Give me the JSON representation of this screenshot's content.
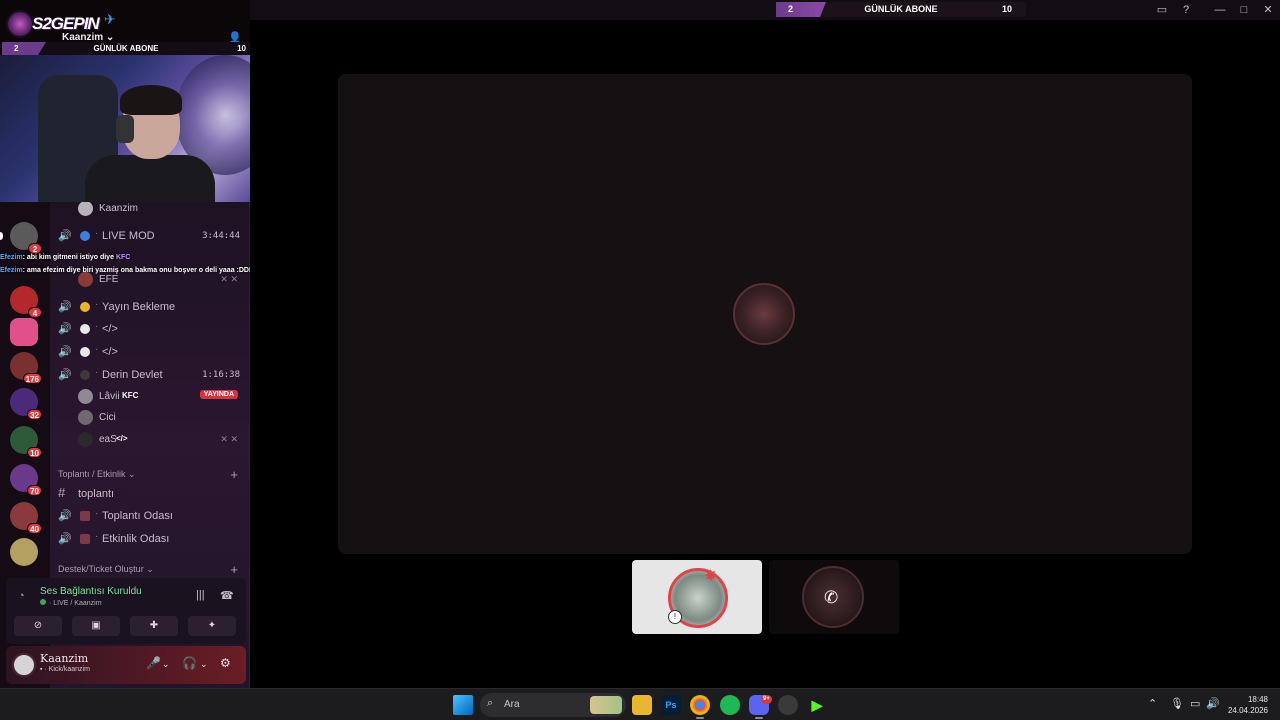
{
  "goal_bar": {
    "current": "2",
    "label": "GÜNLÜK ABONE",
    "target": "10",
    "progress_fraction": 0.2
  },
  "overlay": {
    "brand_text": "S2GEPIN",
    "server_name": "Kaanzim",
    "goal": {
      "current": "2",
      "label": "GÜNLÜK ABONE",
      "target": "10"
    }
  },
  "channels": {
    "voice_top_user": "Kaanzim",
    "live_mod": {
      "name": "LIVE MOD",
      "timer": "3:44:44",
      "dot_color": "#3b7fe0"
    },
    "efe_user": "EFE",
    "yayin_bekleme": {
      "name": "Yayın Bekleme",
      "dot_color": "#e6b92b"
    },
    "code1": {
      "name": "</>",
      "dot_color": "#e8e8e8"
    },
    "code2": {
      "name": "</>",
      "dot_color": "#e8e8e8"
    },
    "derin_devlet": {
      "name": "Derin Devlet",
      "timer": "1:16:38",
      "dot_color": "#3a3a3a"
    },
    "users": [
      {
        "name": "Lâvii",
        "tag": "KFC",
        "badge": "YAYINDA"
      },
      {
        "name": "Cici"
      },
      {
        "name": "eaS",
        "tag": "</>"
      }
    ],
    "category_meeting": "Toplantı / Etkinlik",
    "text_channel": "toplantı",
    "meeting_room": "Toplantı Odası",
    "event_room": "Etkinlik Odası",
    "category_support": "Destek/Ticket Oluştur",
    "separator": "·"
  },
  "chat_overlay": [
    {
      "nick": "Efezim",
      "text": ": abi kim gitmeni istiyo diye",
      "tag": "KFC"
    },
    {
      "nick": "Efezim",
      "text": ": ama efezim diye biri yazmiş ona bakma onu boşver o deli yaaa :DDDD",
      "tag": ""
    }
  ],
  "servers": [
    {
      "badge": "2",
      "color": "#5a5a5a"
    },
    {
      "badge": "4",
      "color": "#b2282c"
    },
    {
      "badge": "",
      "color": "#e0508a"
    },
    {
      "badge": "176",
      "color": "#7a3030"
    },
    {
      "badge": "32",
      "color": "#4b2a7a"
    },
    {
      "badge": "10",
      "color": "#2e5a3a"
    },
    {
      "badge": "70",
      "color": "#6a3a8a"
    },
    {
      "badge": "40",
      "color": "#8a3a3a"
    },
    {
      "badge": "",
      "color": "#b4a060"
    }
  ],
  "voice_status": {
    "title": "Ses Bağlantısı Kuruldu",
    "subtitle": "LIVE / Kaanzim"
  },
  "user_panel": {
    "name": "Kaanzim",
    "status": "Kick/kaanzim"
  },
  "taskbar": {
    "search_placeholder": "Ara",
    "ps_label": "Ps",
    "discord_badge": "9+",
    "time": "18:48",
    "date": "24.04.2026"
  },
  "colors": {
    "accent_purple": "#6a3c8a",
    "live_red": "#d8323f",
    "connected_green": "#7fe09a",
    "discord_blue": "#5865f2"
  }
}
